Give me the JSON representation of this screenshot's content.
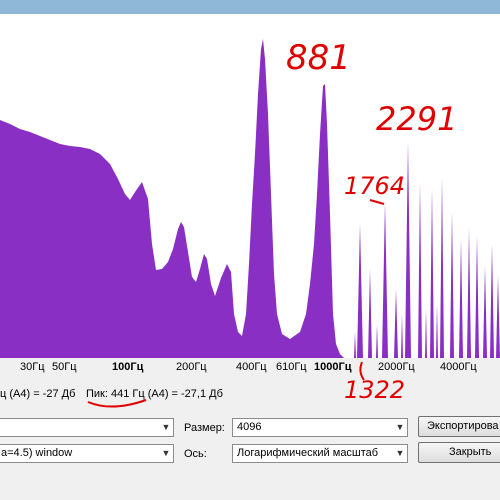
{
  "axis": {
    "ticks": [
      {
        "label": "30Гц",
        "bold": false
      },
      {
        "label": "50Гц",
        "bold": false
      },
      {
        "label": "100Гц",
        "bold": true
      },
      {
        "label": "200Гц",
        "bold": false
      },
      {
        "label": "400Гц",
        "bold": false
      },
      {
        "label": "610Гц",
        "bold": false
      },
      {
        "label": "1000Гц",
        "bold": true
      },
      {
        "label": "2000Гц",
        "bold": false
      },
      {
        "label": "4000Гц",
        "bold": false
      }
    ]
  },
  "cursor_info": "ц (A4) = -27 Дб",
  "peak_info": "Пик: 441 Гц (A4) = -27,1 Дб",
  "controls": {
    "algorithm_value": "",
    "size_label": "Размер:",
    "size_value": "4096",
    "export_label": "Экспортирова",
    "function_value": "a=4.5) window",
    "axis_label": "Ось:",
    "axis_value": "Логарифмический масштаб",
    "close_label": "Закрыть"
  },
  "annotations": {
    "peak_881": "881",
    "peak_2291": "2291",
    "peak_1764": "1764",
    "peak_1322": "1322"
  },
  "colors": {
    "spectrum": "#8a2fc4",
    "annotation": "#e00000"
  }
}
